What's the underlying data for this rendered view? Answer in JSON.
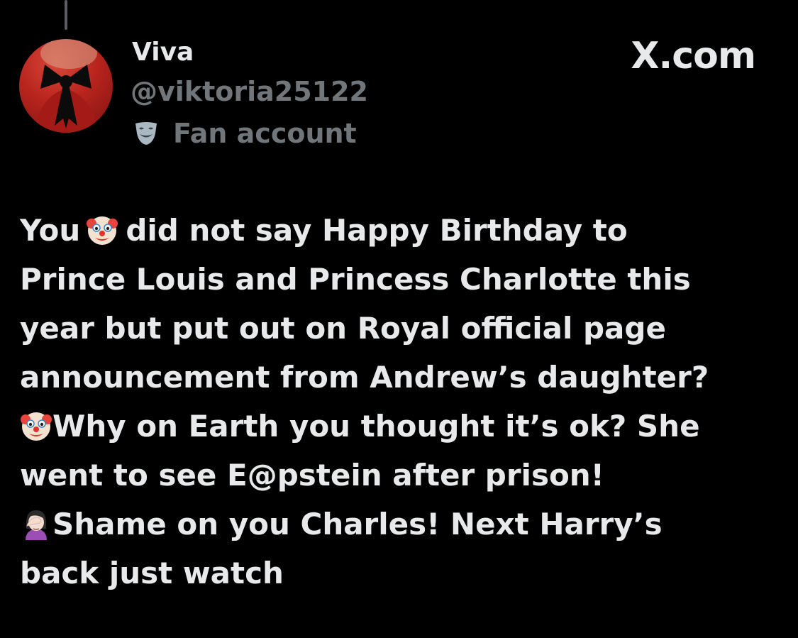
{
  "author": {
    "display_name": "Viva",
    "handle": "@viktoria25122",
    "label": "Fan account",
    "label_icon": "theater-mask-icon",
    "avatar": "profile-avatar-red-bow"
  },
  "site": {
    "mark": "X.com",
    "brand_color": "#e7e9ea"
  },
  "tweet": {
    "line1_a": "You",
    "line1_emoji": "clown-face-emoji",
    "line1_b": "did not say Happy Birthday to",
    "line2": "Prince Louis and Princess Charlotte this",
    "line3": "year but put out on Royal official page",
    "line4": "announcement from Andrew’s daughter?",
    "line5_emoji": "clown-face-emoji",
    "line5": "Why on Earth you thought it’s ok? She",
    "line6": "went to see E@pstein after prison!",
    "line7_emoji": "woman-facepalming-emoji",
    "line7": "Shame on you Charles! Next Harry’s",
    "line8": "back just watch"
  },
  "colors": {
    "background": "#000000",
    "primary_text": "#e7e9ea",
    "secondary_text": "#71767b"
  }
}
